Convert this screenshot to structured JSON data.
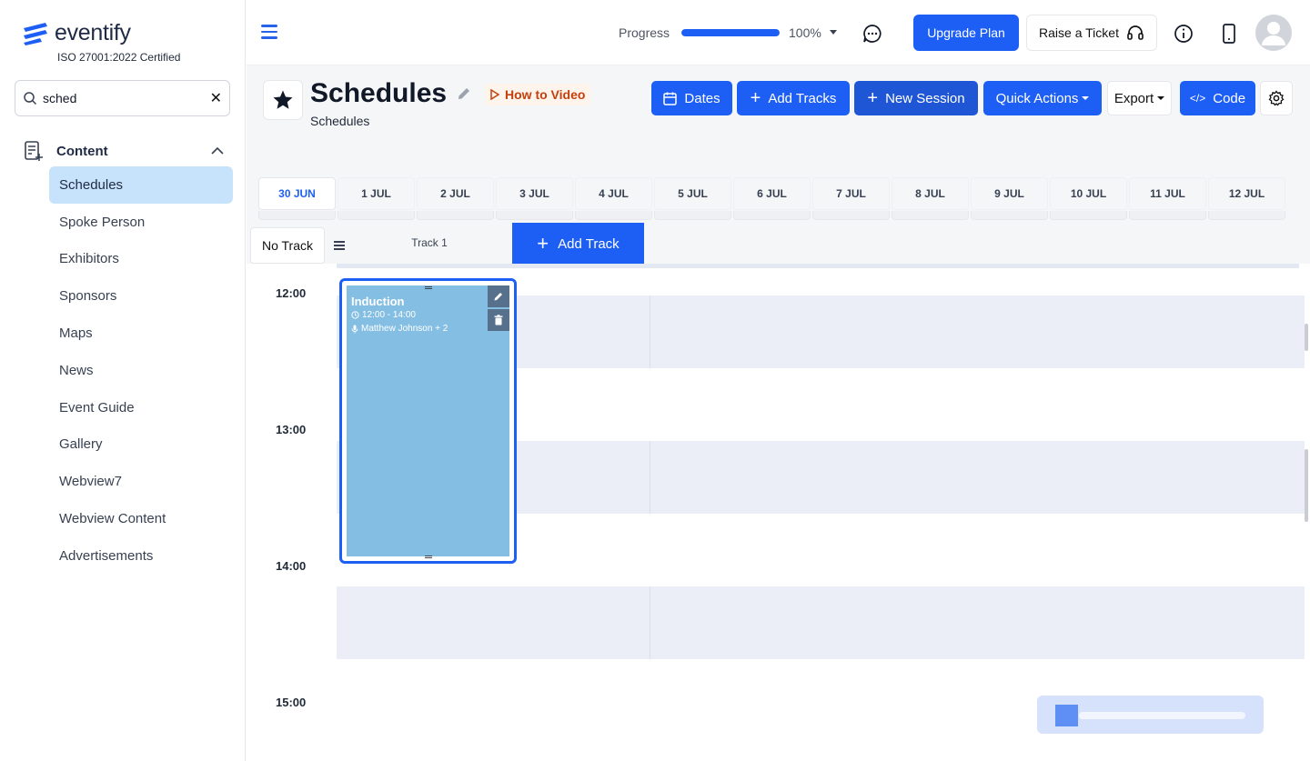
{
  "brand": {
    "logo_text": "eventify",
    "certification": "ISO 27001:2022 Certified",
    "color": "#1d5ff5"
  },
  "search": {
    "value": "sched"
  },
  "sidebar": {
    "section_label": "Content",
    "items": [
      {
        "label": "Schedules",
        "active": true
      },
      {
        "label": "Spoke Person"
      },
      {
        "label": "Exhibitors"
      },
      {
        "label": "Sponsors"
      },
      {
        "label": "Maps"
      },
      {
        "label": "News"
      },
      {
        "label": "Event Guide"
      },
      {
        "label": "Gallery"
      },
      {
        "label": "Webview7"
      },
      {
        "label": "Webview Content"
      },
      {
        "label": "Advertisements"
      }
    ]
  },
  "topbar": {
    "progress_label": "Progress",
    "progress_value": 100,
    "progress_text": "100%",
    "upgrade_label": "Upgrade Plan",
    "ticket_label": "Raise a Ticket"
  },
  "page": {
    "title": "Schedules",
    "subtitle": "Schedules",
    "how_to_label": "How to Video"
  },
  "toolbar": {
    "dates_label": "Dates",
    "add_tracks_label": "Add Tracks",
    "new_session_label": "New Session",
    "quick_actions_label": "Quick Actions",
    "export_label": "Export",
    "code_label": "Code"
  },
  "dates": [
    "30 JUN",
    "1 JUL",
    "2 JUL",
    "3 JUL",
    "4 JUL",
    "5 JUL",
    "6 JUL",
    "7 JUL",
    "8 JUL",
    "9 JUL",
    "10 JUL",
    "11 JUL",
    "12 JUL"
  ],
  "active_date_index": 0,
  "calendar": {
    "no_track_label": "No Track",
    "track_name": "Track 1",
    "add_track_label": "Add Track",
    "times": [
      "12:00",
      "13:00",
      "14:00",
      "15:00"
    ]
  },
  "session": {
    "title": "Induction",
    "time": "12:00 - 14:00",
    "speakers": "Matthew Johnson + 2",
    "color": "#84bfe3"
  }
}
